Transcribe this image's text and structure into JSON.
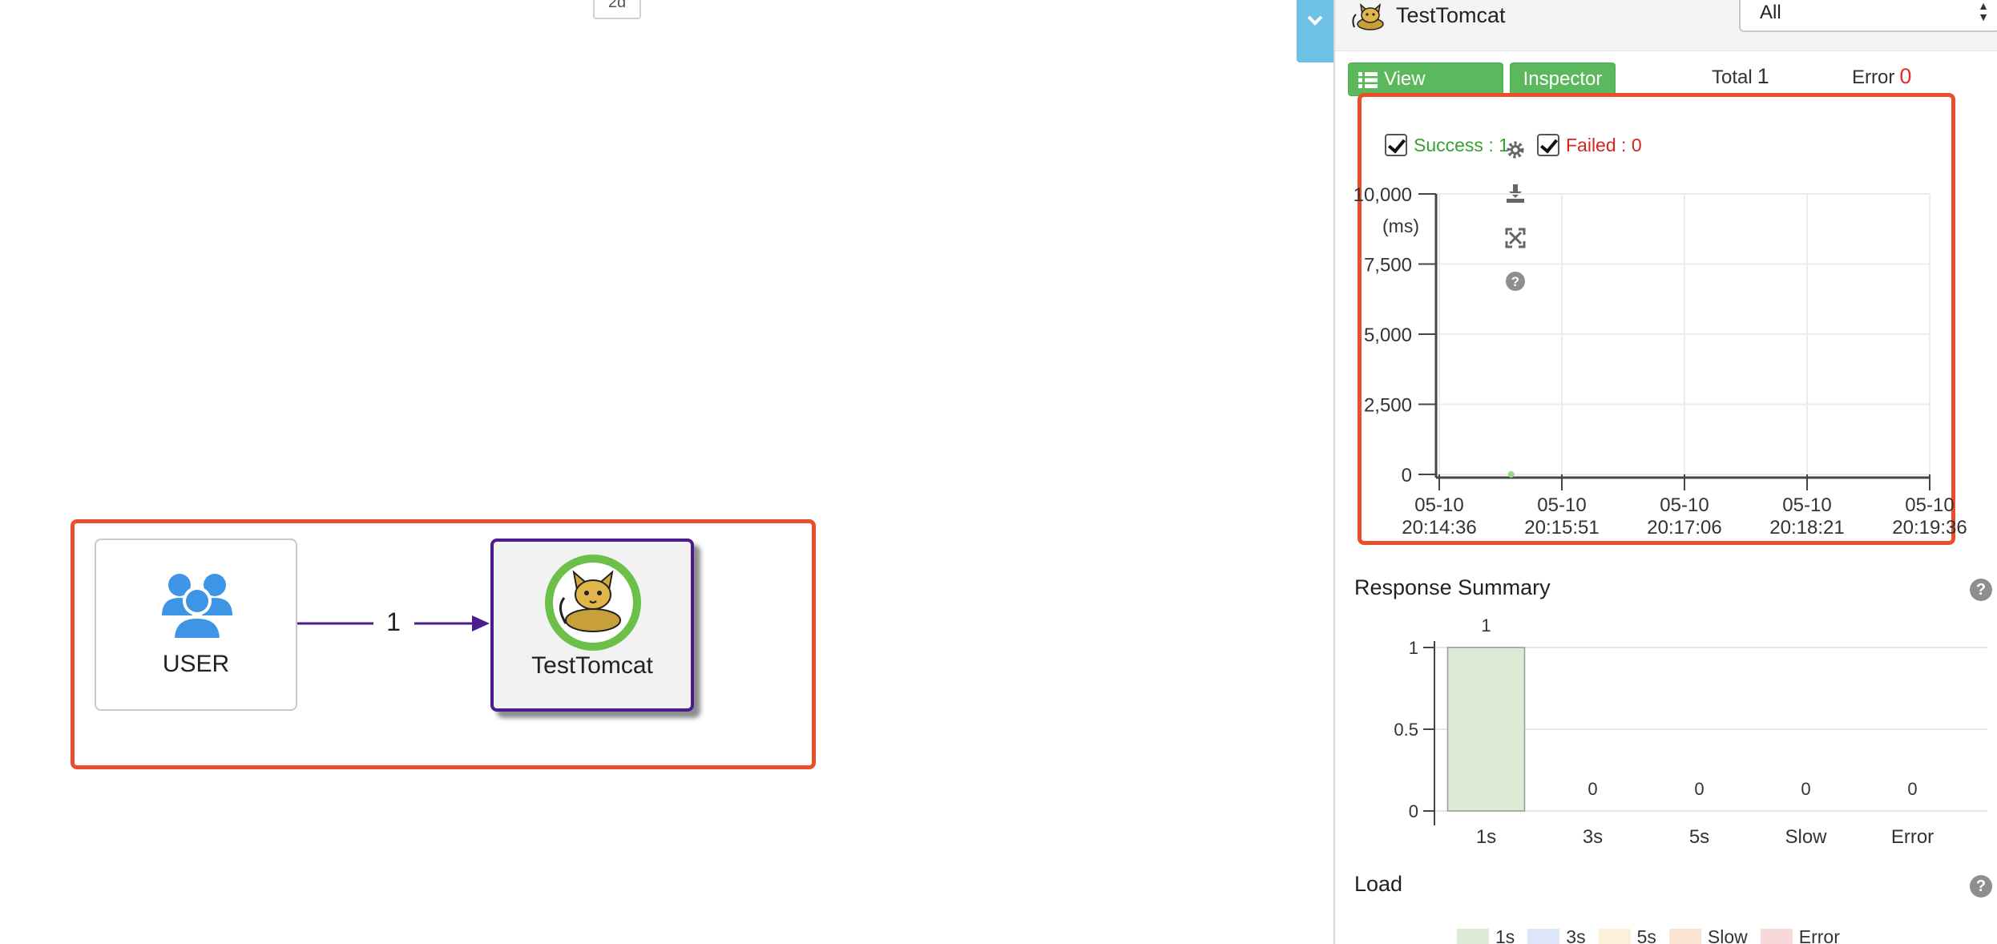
{
  "canvas": {
    "top_chip_label": "2d",
    "user_node_label": "USER",
    "edge_count": "1",
    "tomcat_node_label": "TestTomcat"
  },
  "panel": {
    "title": "TestTomcat",
    "agent_select_value": "All",
    "view_servers_label": "View Servers",
    "inspector_label": "Inspector",
    "total_label": "Total",
    "total_value": "1",
    "error_label": "Error",
    "error_value": "0",
    "success_label": "Success : 1",
    "failed_label": "Failed : 0",
    "response_summary_title": "Response Summary",
    "load_title": "Load",
    "colors": {
      "success": "#38a02e",
      "failed": "#d62424",
      "accent_green": "#5cb85c",
      "highlight": "#ec4e2b",
      "node_border": "#4b1c8e"
    }
  },
  "tools": [
    "gear-icon",
    "download-icon",
    "fullscreen-icon",
    "help-icon"
  ],
  "chart_data": [
    {
      "type": "scatter",
      "title": "",
      "ylabel": "(ms)",
      "yticks": [
        "10,000",
        "7,500",
        "5,000",
        "2,500",
        "0"
      ],
      "ylim": [
        0,
        10000
      ],
      "xticks": [
        [
          "05-10",
          "20:14:36"
        ],
        [
          "05-10",
          "20:15:51"
        ],
        [
          "05-10",
          "20:17:06"
        ],
        [
          "05-10",
          "20:18:21"
        ],
        [
          "05-10",
          "20:19:36"
        ]
      ],
      "xlim": [
        "05-10 20:14:36",
        "05-10 20:19:36"
      ],
      "series": [
        {
          "name": "Success",
          "points": [
            {
              "x": "05-10 20:15:20",
              "y": 0
            }
          ]
        },
        {
          "name": "Failed",
          "points": []
        }
      ],
      "grid": true
    },
    {
      "type": "bar",
      "title": "Response Summary",
      "categories": [
        "1s",
        "3s",
        "5s",
        "Slow",
        "Error"
      ],
      "values": [
        1,
        0,
        0,
        0,
        0
      ],
      "yticks": [
        "1",
        "0.5",
        "0"
      ],
      "ylim": [
        0,
        1
      ],
      "grid": true
    },
    {
      "type": "bar",
      "title": "Load",
      "legend": [
        "1s",
        "3s",
        "5s",
        "Slow",
        "Error"
      ],
      "legend_colors": [
        "#dcebd6",
        "#dce6f8",
        "#fbf1da",
        "#fbe4d2",
        "#f7d9dc"
      ],
      "legend_placement": "top"
    }
  ]
}
